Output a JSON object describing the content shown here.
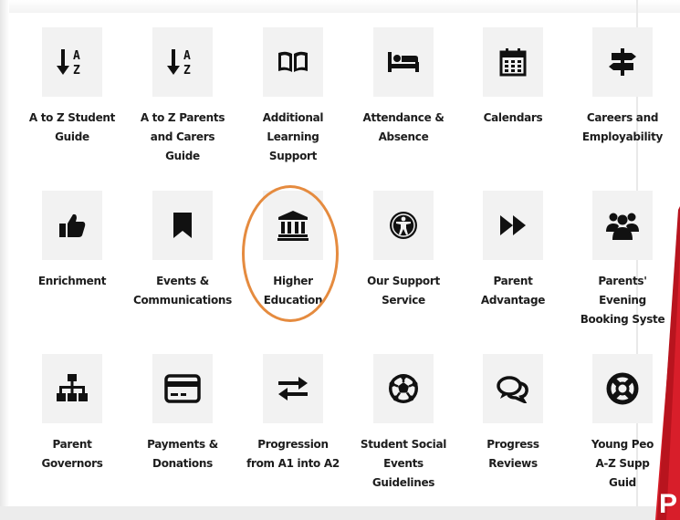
{
  "accent": {
    "highlight": "#e58b3f",
    "brand_red": "#d81e2a"
  },
  "items": [
    {
      "icon": "a-z-sort-icon",
      "lines": [
        "A to Z Student",
        "Guide"
      ]
    },
    {
      "icon": "a-z-sort-icon",
      "lines": [
        "A to Z Parents",
        "and Carers",
        "Guide"
      ]
    },
    {
      "icon": "open-book-icon",
      "lines": [
        "Additional",
        "Learning",
        "Support"
      ]
    },
    {
      "icon": "bed-icon",
      "lines": [
        "Attendance &",
        "Absence"
      ]
    },
    {
      "icon": "calendar-icon",
      "lines": [
        "Calendars"
      ]
    },
    {
      "icon": "signpost-icon",
      "lines": [
        "Careers and",
        "Employability"
      ]
    },
    {
      "icon": "thumbs-up-icon",
      "lines": [
        "Enrichment"
      ]
    },
    {
      "icon": "bookmark-icon",
      "lines": [
        "Events &",
        "Communications"
      ]
    },
    {
      "icon": "university-icon",
      "lines": [
        "Higher",
        "Education"
      ]
    },
    {
      "icon": "universal-access-icon",
      "lines": [
        "Our Support",
        "Service"
      ]
    },
    {
      "icon": "fast-forward-icon",
      "lines": [
        "Parent",
        "Advantage"
      ]
    },
    {
      "icon": "users-icon",
      "lines": [
        "Parents'",
        "Evening",
        "Booking Syste"
      ]
    },
    {
      "icon": "sitemap-icon",
      "lines": [
        "Parent",
        "Governors"
      ]
    },
    {
      "icon": "credit-card-icon",
      "lines": [
        "Payments &",
        "Donations"
      ]
    },
    {
      "icon": "exchange-arrows-icon",
      "lines": [
        "Progression",
        "from A1 into A2"
      ]
    },
    {
      "icon": "football-icon",
      "lines": [
        "Student Social",
        "Events",
        "Guidelines"
      ]
    },
    {
      "icon": "comments-icon",
      "lines": [
        "Progress",
        "Reviews"
      ]
    },
    {
      "icon": "life-ring-icon",
      "lines": [
        "Young Peo",
        "A-Z Supp",
        "Guid"
      ]
    }
  ],
  "corner_text": "P"
}
